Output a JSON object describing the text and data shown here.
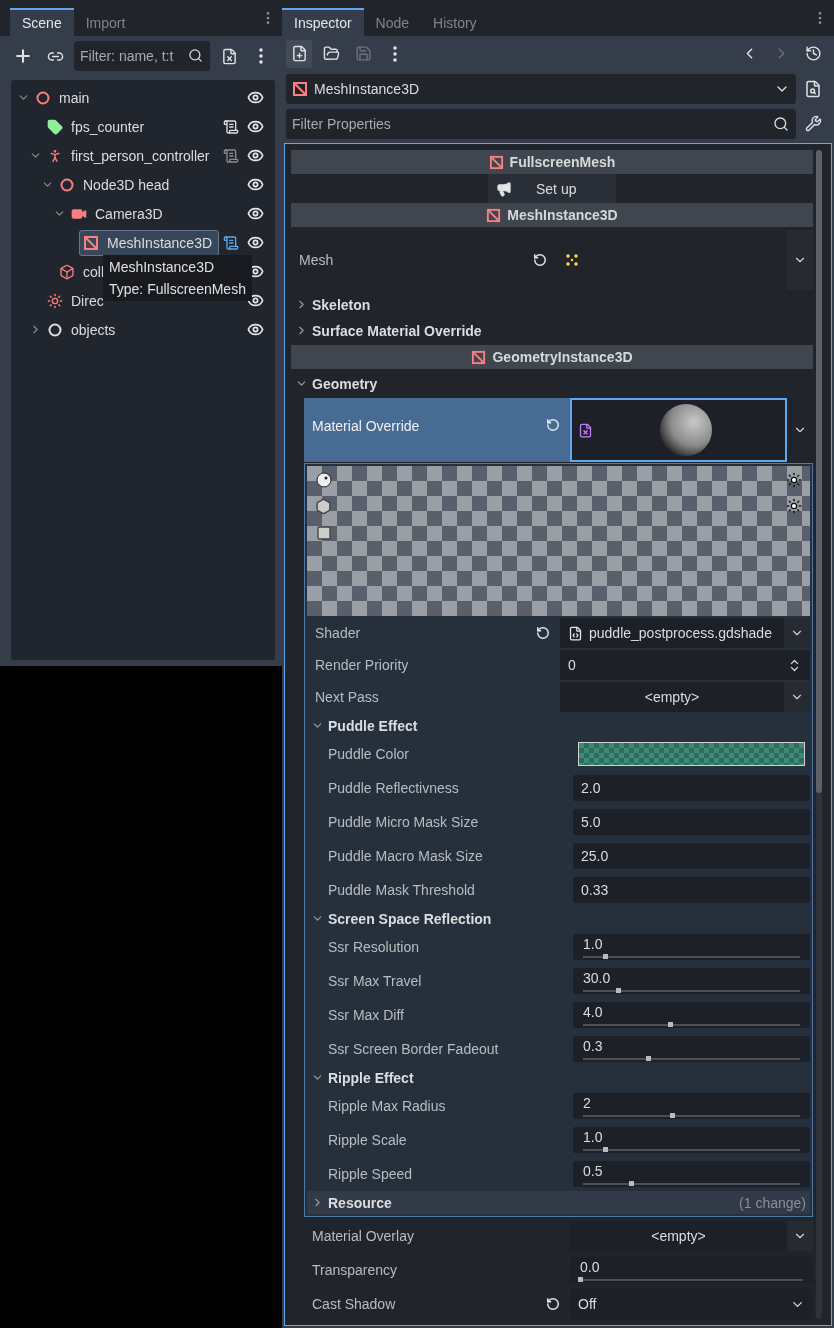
{
  "scene_dock": {
    "tabs": [
      {
        "label": "Scene",
        "selected": true
      },
      {
        "label": "Import",
        "selected": false
      }
    ],
    "filter": {
      "placeholder": "Filter: name, t:t"
    },
    "tree": [
      {
        "name": "main",
        "kind": "node3d",
        "expanded": true,
        "selected": false,
        "children": [
          {
            "name": "fps_counter",
            "kind": "label",
            "selected": false,
            "script": {
              "color": "#e0e0e0"
            }
          },
          {
            "name": "first_person_controller",
            "kind": "character",
            "expanded": true,
            "selected": false,
            "script": {
              "color": "#8a8a8a"
            },
            "children": [
              {
                "name": "Node3D head",
                "kind": "node3d",
                "expanded": true,
                "selected": false,
                "children": [
                  {
                    "name": "Camera3D",
                    "kind": "camera",
                    "expanded": true,
                    "selected": false,
                    "children": [
                      {
                        "name": "MeshInstance3D",
                        "kind": "mesh",
                        "selected": true,
                        "script": {
                          "color": "#5fa8e8"
                        }
                      }
                    ]
                  }
                ]
              },
              {
                "name": "coll",
                "kind": "collision",
                "selected": false
              }
            ]
          },
          {
            "name": "Direc",
            "kind": "light",
            "selected": false
          },
          {
            "name": "objects",
            "kind": "node",
            "expanded": false,
            "selected": false
          }
        ]
      }
    ],
    "tooltip": {
      "title": "MeshInstance3D",
      "type": "Type: FullscreenMesh"
    }
  },
  "inspector": {
    "tabs": [
      {
        "label": "Inspector",
        "selected": true
      },
      {
        "label": "Node",
        "selected": false
      },
      {
        "label": "History",
        "selected": false
      }
    ],
    "object": "MeshInstance3D",
    "filter": {
      "placeholder": "Filter Properties"
    },
    "rows": [
      {
        "kind": "category",
        "label": "FullscreenMesh"
      },
      {
        "kind": "button",
        "label": "Set up"
      },
      {
        "kind": "category",
        "label": "MeshInstance3D"
      },
      {
        "kind": "mesh",
        "label": "Mesh",
        "revert": true
      },
      {
        "kind": "group",
        "label": "Skeleton",
        "expanded": false
      },
      {
        "kind": "group",
        "label": "Surface Material Override",
        "expanded": false
      },
      {
        "kind": "category",
        "label": "GeometryInstance3D"
      },
      {
        "kind": "group",
        "label": "Geometry",
        "expanded": true,
        "children": [
          {
            "kind": "material",
            "label": "Material Override",
            "revert": true,
            "selected": true,
            "resource": {
              "rows": [
                {
                  "kind": "file",
                  "label": "Shader",
                  "value": "puddle_postprocess.gdshade",
                  "revert": true
                },
                {
                  "kind": "spin",
                  "label": "Render Priority",
                  "value": "0"
                },
                {
                  "kind": "resource",
                  "label": "Next Pass",
                  "value": "<empty>"
                },
                {
                  "kind": "group",
                  "label": "Puddle Effect",
                  "expanded": true,
                  "children": [
                    {
                      "kind": "color",
                      "label": "Puddle Color",
                      "color": "#3d8a76"
                    },
                    {
                      "kind": "number",
                      "label": "Puddle Reflectivness",
                      "value": "2.0"
                    },
                    {
                      "kind": "number",
                      "label": "Puddle Micro Mask Size",
                      "value": "5.0"
                    },
                    {
                      "kind": "number",
                      "label": "Puddle Macro Mask Size",
                      "value": "25.0"
                    },
                    {
                      "kind": "number",
                      "label": "Puddle Mask Threshold",
                      "value": "0.33"
                    }
                  ]
                },
                {
                  "kind": "group",
                  "label": "Screen Space Reflection",
                  "expanded": true,
                  "children": [
                    {
                      "kind": "slider",
                      "label": "Ssr Resolution",
                      "value": "1.0",
                      "level": 0.1
                    },
                    {
                      "kind": "slider",
                      "label": "Ssr Max Travel",
                      "value": "30.0",
                      "level": 0.16
                    },
                    {
                      "kind": "slider",
                      "label": "Ssr Max Diff",
                      "value": "4.0",
                      "level": 0.4
                    },
                    {
                      "kind": "slider",
                      "label": "Ssr Screen Border Fadeout",
                      "value": "0.3",
                      "level": 0.3
                    }
                  ]
                },
                {
                  "kind": "group",
                  "label": "Ripple Effect",
                  "expanded": true,
                  "children": [
                    {
                      "kind": "slider",
                      "label": "Ripple Max Radius",
                      "value": "2",
                      "level": 0.41
                    },
                    {
                      "kind": "slider",
                      "label": "Ripple Scale",
                      "value": "1.0",
                      "level": 0.1
                    },
                    {
                      "kind": "slider",
                      "label": "Ripple Speed",
                      "value": "0.5",
                      "level": 0.22
                    }
                  ]
                },
                {
                  "kind": "group",
                  "label": "Resource",
                  "expanded": false,
                  "note": "(1 change)"
                }
              ]
            }
          },
          {
            "kind": "resource",
            "label": "Material Overlay",
            "value": "<empty>"
          },
          {
            "kind": "slider",
            "label": "Transparency",
            "value": "0.0",
            "level": 0
          },
          {
            "kind": "enum",
            "label": "Cast Shadow",
            "value": "Off",
            "revert": true
          }
        ]
      }
    ]
  }
}
